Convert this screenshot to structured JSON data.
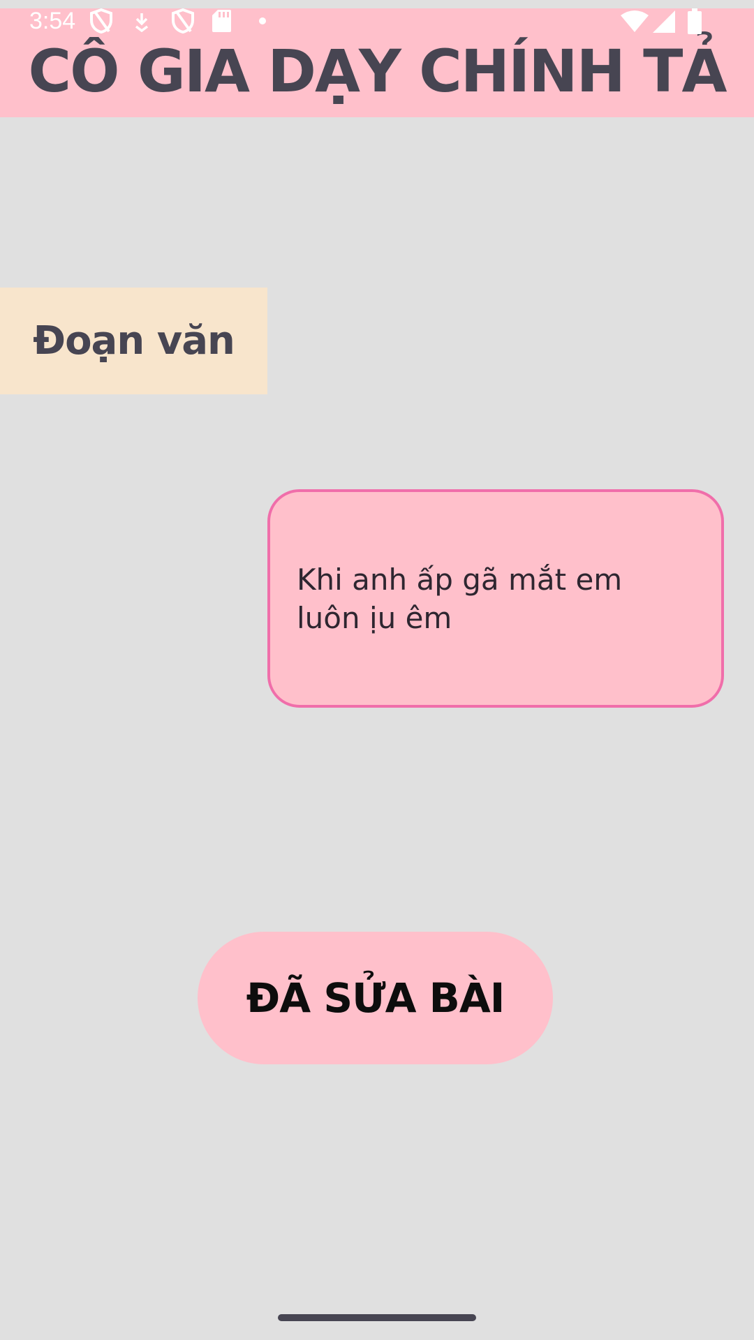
{
  "status_bar": {
    "time": "3:54",
    "icons": [
      "shield-icon",
      "download-icon",
      "shield-icon",
      "sd-card-icon",
      "dot-icon",
      "wifi-icon",
      "signal-icon",
      "battery-icon"
    ]
  },
  "header": {
    "title": "CÔ GIA DẠY CHÍNH TẢ"
  },
  "label_card": {
    "text": "Đoạn văn"
  },
  "text_box": {
    "content": "Khi anh ấp gã mắt em luôn ịu êm"
  },
  "submit_button": {
    "label": "ĐÃ SỬA BÀI"
  },
  "colors": {
    "background": "#e0e0e0",
    "header_bg": "#ffc0cb",
    "label_bg": "#f8e5cc",
    "text_box_bg": "#ffc0cb",
    "text_box_border": "#f06eaa",
    "button_bg": "#ffc0cb",
    "title_text": "#474552"
  }
}
